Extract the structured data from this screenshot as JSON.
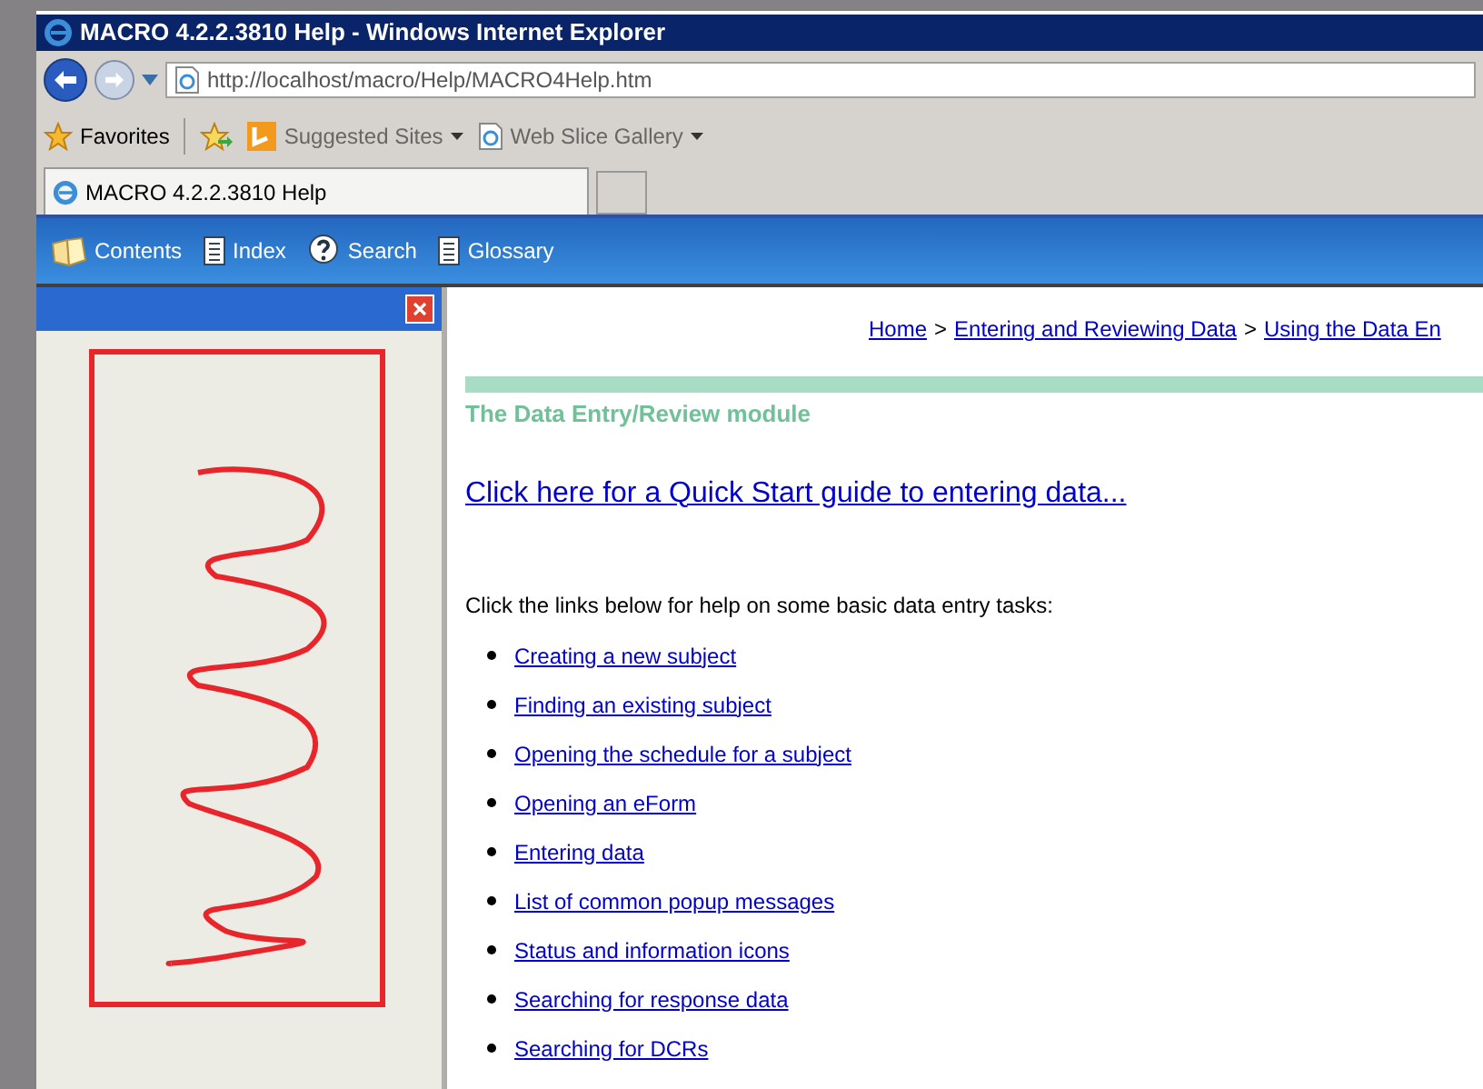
{
  "window": {
    "title": "MACRO 4.2.2.3810 Help - Windows Internet Explorer"
  },
  "address_bar": {
    "value": "http://localhost/macro/Help/MACRO4Help.htm"
  },
  "favorites_bar": {
    "favorites": "Favorites",
    "items": [
      {
        "label": "Suggested Sites",
        "kind": "bing"
      },
      {
        "label": "Web Slice Gallery",
        "kind": "ie"
      }
    ]
  },
  "tabs": [
    {
      "label": "MACRO 4.2.2.3810 Help",
      "selected": true
    }
  ],
  "help_toolbar": [
    {
      "label": "Contents",
      "kind": "contents"
    },
    {
      "label": "Index",
      "kind": "page"
    },
    {
      "label": "Search",
      "kind": "search"
    },
    {
      "label": "Glossary",
      "kind": "page"
    }
  ],
  "content": {
    "breadcrumb": [
      "Home",
      "Entering and Reviewing Data",
      "Using the Data En"
    ],
    "breadcrumb_separators": [
      ">",
      ">"
    ],
    "heading": "The Data Entry/Review module",
    "quick_start_link": "Click here for a Quick Start guide to entering data...",
    "intro": "Click the links below for help on some basic data entry tasks:",
    "links": [
      "Creating a new subject",
      "Finding an existing subject",
      "Opening the schedule for a subject",
      "Opening an eForm",
      "Entering data",
      "List of common popup messages",
      "Status and information icons",
      "Searching for response data",
      "Searching for DCRs"
    ]
  }
}
